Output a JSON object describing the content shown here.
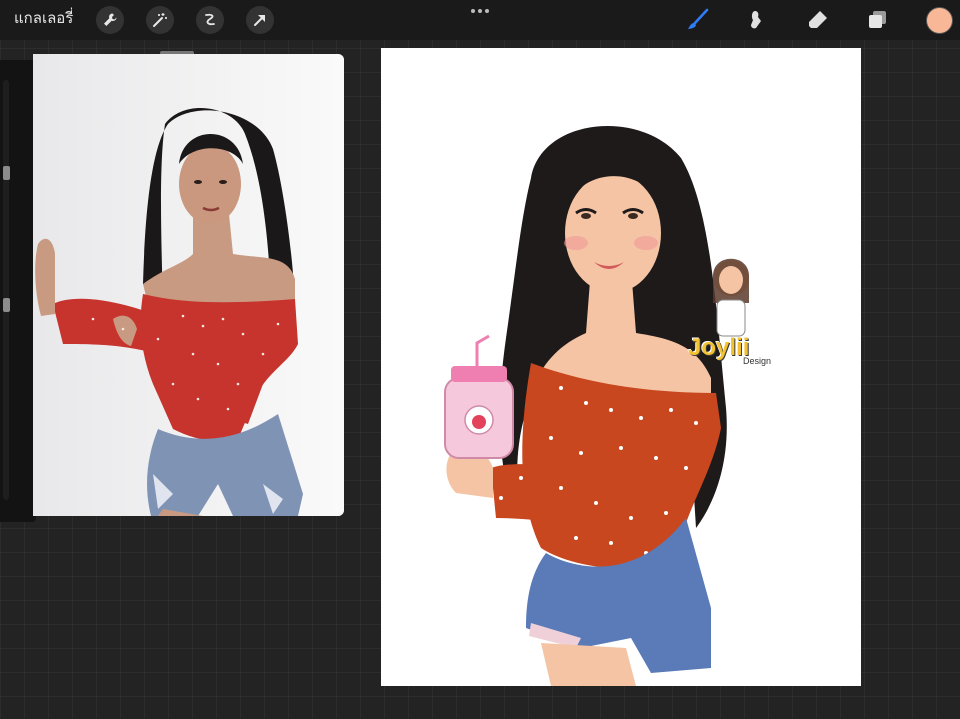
{
  "toolbar": {
    "gallery_label": "แกลเลอรี่",
    "left_tools": [
      {
        "name": "wrench-icon"
      },
      {
        "name": "magic-wand-icon"
      },
      {
        "name": "selection-icon"
      },
      {
        "name": "transform-arrow-icon"
      }
    ],
    "right_tools": [
      {
        "name": "brush-icon",
        "active": true
      },
      {
        "name": "smudge-icon"
      },
      {
        "name": "eraser-icon"
      },
      {
        "name": "layers-icon"
      }
    ],
    "current_color": "#f8b897",
    "active_color": "#2f7cf6"
  },
  "reference_window": {
    "description_icon": "reference-photo"
  },
  "canvas": {
    "watermark_line1": "Joylii",
    "watermark_line2": "Design",
    "colors": {
      "hair": "#1e1a1a",
      "skin": "#f4c4a4",
      "top": "#c8471e",
      "denim": "#5a7ab8",
      "bottle": "#f6c8dc"
    }
  }
}
